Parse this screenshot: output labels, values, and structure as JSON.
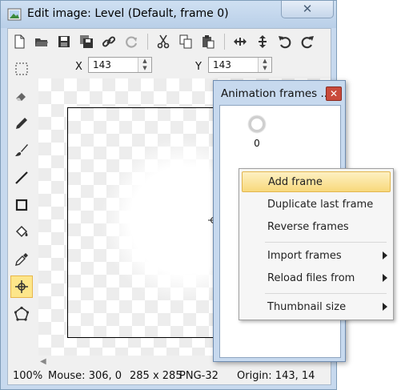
{
  "window": {
    "title": "Edit image: Level (Default, frame 0)",
    "close_glyph": "✕"
  },
  "coords": {
    "x_label": "X",
    "x_value": "143",
    "y_label": "Y",
    "y_value": "143"
  },
  "toolbar": {
    "icons": [
      "new-icon",
      "open-icon",
      "save-icon",
      "save-all-icon",
      "link-icon",
      "refresh-icon",
      "cut-icon",
      "copy-icon",
      "paste-icon",
      "move-h-icon",
      "move-v-icon",
      "undo-icon",
      "redo-icon"
    ]
  },
  "tools": [
    "select-rect-icon",
    "eraser-icon",
    "pencil-icon",
    "brush-icon",
    "line-icon",
    "rectangle-icon",
    "fill-bucket-icon",
    "eyedropper-icon",
    "origin-icon",
    "polygon-icon"
  ],
  "statusbar": {
    "zoom": "100%",
    "mouse": "Mouse: 306, 0",
    "size": "285 x 285",
    "format": "PNG-32",
    "origin": "Origin: 143, 14"
  },
  "anim_panel": {
    "title": "Animation frames ...",
    "frames": [
      {
        "label": "0"
      }
    ]
  },
  "context_menu": {
    "items": [
      {
        "label": "Add frame",
        "highlighted": true
      },
      {
        "label": "Duplicate last frame"
      },
      {
        "label": "Reverse frames"
      },
      {
        "label": "Import frames",
        "submenu": true
      },
      {
        "label": "Reload files from",
        "submenu": true
      },
      {
        "label": "Thumbnail size",
        "submenu": true
      }
    ]
  },
  "colors": {
    "accent": "#fde68a",
    "window_frame": "#c7d9ee",
    "close_red": "#c94a3b"
  }
}
